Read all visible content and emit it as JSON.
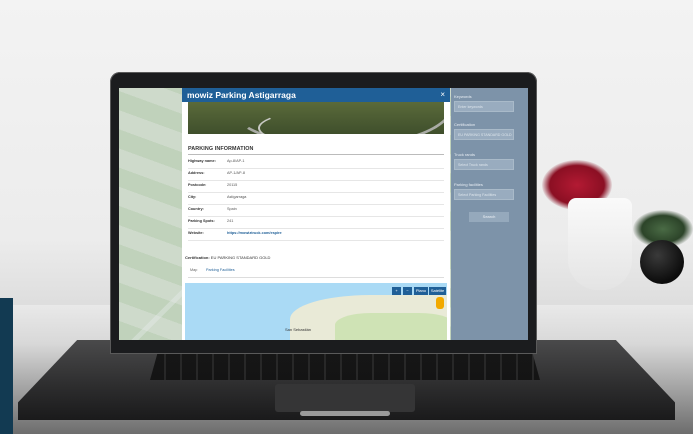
{
  "modal": {
    "title": "mowiz Parking Astigarraga",
    "close_icon": "×",
    "section_title": "PARKING INFORMATION",
    "rows": [
      {
        "label": "Highway name:",
        "value": "Ap-8/AP-1"
      },
      {
        "label": "Address:",
        "value": "AP-1/AP-8"
      },
      {
        "label": "Postcode:",
        "value": "20115"
      },
      {
        "label": "City:",
        "value": "Astigarraga"
      },
      {
        "label": "Country:",
        "value": "Spain"
      },
      {
        "label": "Parking Spots:",
        "value": "241"
      },
      {
        "label": "Website:",
        "value": "https://mowiztruck.com/espire"
      }
    ],
    "certification_label": "Certification:",
    "certification_value": "EU PARKING STANDARD GOLD",
    "tabs": [
      "Map",
      "Parking Facilities"
    ],
    "active_tab": "Map"
  },
  "minimap": {
    "zoom_in": "+",
    "zoom_out": "−",
    "map_type": "Plano",
    "satellite": "Satélite",
    "place_label": "San Sebastián"
  },
  "filters": {
    "keywords_label": "Keywords",
    "keywords_placeholder": "Enter keywords",
    "certification_label": "Certification",
    "certification_value": "EU PARKING STANDARD GOLD",
    "truck_label": "Truck rands",
    "truck_placeholder": "Select Truck rands",
    "facilities_label": "Parking facilities",
    "facilities_placeholder": "Select Parking Facilities",
    "search_button": "Search"
  },
  "colors": {
    "header_blue": "#1f5f97",
    "filter_panel": "#7d93a9"
  }
}
